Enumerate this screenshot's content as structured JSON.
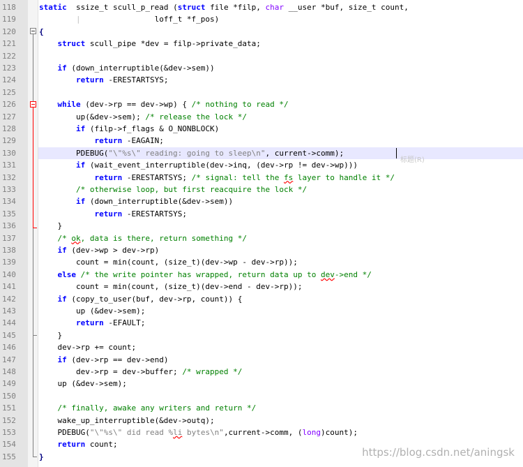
{
  "editor": {
    "current_line": 130,
    "lines": [
      {
        "n": "118",
        "segs": [
          [
            "kw",
            "static"
          ],
          [
            "",
            "  ssize_t scull_p_read ("
          ],
          [
            "kw",
            "struct"
          ],
          [
            "",
            " file *filp, "
          ],
          [
            "ty",
            "char"
          ],
          [
            "",
            " __user *buf, size_t count,"
          ]
        ]
      },
      {
        "n": "119",
        "segs": [
          [
            "tabmark",
            "        |          "
          ],
          [
            "",
            "      loff_t *f_pos)"
          ]
        ]
      },
      {
        "n": "120",
        "segs": [
          [
            "op",
            "{"
          ]
        ]
      },
      {
        "n": "121",
        "segs": [
          [
            "",
            "    "
          ],
          [
            "kw",
            "struct"
          ],
          [
            "",
            " scull_pipe *dev = filp->private_data;"
          ]
        ]
      },
      {
        "n": "122",
        "segs": [
          [
            "",
            ""
          ]
        ]
      },
      {
        "n": "123",
        "segs": [
          [
            "",
            "    "
          ],
          [
            "kw",
            "if"
          ],
          [
            "",
            " (down_interruptible(&dev->sem))"
          ]
        ]
      },
      {
        "n": "124",
        "segs": [
          [
            "",
            "        "
          ],
          [
            "kw",
            "return"
          ],
          [
            "",
            " -ERESTARTSYS;"
          ]
        ]
      },
      {
        "n": "125",
        "segs": [
          [
            "",
            ""
          ]
        ]
      },
      {
        "n": "126",
        "segs": [
          [
            "",
            "    "
          ],
          [
            "kw",
            "while"
          ],
          [
            "",
            " (dev->rp == dev->wp) { "
          ],
          [
            "cm",
            "/* nothing to read */"
          ]
        ]
      },
      {
        "n": "127",
        "segs": [
          [
            "",
            "        up(&dev->sem); "
          ],
          [
            "cm",
            "/* release the lock */"
          ]
        ]
      },
      {
        "n": "128",
        "segs": [
          [
            "",
            "        "
          ],
          [
            "kw",
            "if"
          ],
          [
            "",
            " (filp->f_flags & O_NONBLOCK)"
          ]
        ]
      },
      {
        "n": "129",
        "segs": [
          [
            "",
            "            "
          ],
          [
            "kw",
            "return"
          ],
          [
            "",
            " -EAGAIN;"
          ]
        ]
      },
      {
        "n": "130",
        "segs": [
          [
            "",
            "        PDEBUG("
          ],
          [
            "st",
            "\"\\\"%s\\\" reading: going to sleep\\n\""
          ],
          [
            "",
            ", current->comm);"
          ]
        ]
      },
      {
        "n": "131",
        "segs": [
          [
            "",
            "        "
          ],
          [
            "kw",
            "if"
          ],
          [
            "",
            " (wait_event_interruptible(dev->inq, (dev->rp != dev->wp)))"
          ]
        ]
      },
      {
        "n": "132",
        "segs": [
          [
            "",
            "            "
          ],
          [
            "kw",
            "return"
          ],
          [
            "",
            " -ERESTARTSYS; "
          ],
          [
            "cm",
            "/* signal: tell the "
          ],
          [
            "cm sq",
            "fs"
          ],
          [
            "cm",
            " layer to handle it */"
          ]
        ]
      },
      {
        "n": "133",
        "segs": [
          [
            "",
            "        "
          ],
          [
            "cm",
            "/* otherwise loop, but first reacquire the lock */"
          ]
        ]
      },
      {
        "n": "134",
        "segs": [
          [
            "",
            "        "
          ],
          [
            "kw",
            "if"
          ],
          [
            "",
            " (down_interruptible(&dev->sem))"
          ]
        ]
      },
      {
        "n": "135",
        "segs": [
          [
            "",
            "            "
          ],
          [
            "kw",
            "return"
          ],
          [
            "",
            " -ERESTARTSYS;"
          ]
        ]
      },
      {
        "n": "136",
        "segs": [
          [
            "",
            "    }"
          ]
        ]
      },
      {
        "n": "137",
        "segs": [
          [
            "",
            "    "
          ],
          [
            "cm",
            "/* "
          ],
          [
            "cm sq",
            "ok"
          ],
          [
            "cm",
            ", data is there, return something */"
          ]
        ]
      },
      {
        "n": "138",
        "segs": [
          [
            "",
            "    "
          ],
          [
            "kw",
            "if"
          ],
          [
            "",
            " (dev->wp > dev->rp)"
          ]
        ]
      },
      {
        "n": "139",
        "segs": [
          [
            "",
            "        count = min(count, (size_t)(dev->wp - dev->rp));"
          ]
        ]
      },
      {
        "n": "140",
        "segs": [
          [
            "",
            "    "
          ],
          [
            "kw",
            "else"
          ],
          [
            "",
            " "
          ],
          [
            "cm",
            "/* the write pointer has wrapped, return data up to "
          ],
          [
            "cm sq",
            "dev"
          ],
          [
            "cm",
            "->end */"
          ]
        ]
      },
      {
        "n": "141",
        "segs": [
          [
            "",
            "        count = min(count, (size_t)(dev->end - dev->rp));"
          ]
        ]
      },
      {
        "n": "142",
        "segs": [
          [
            "",
            "    "
          ],
          [
            "kw",
            "if"
          ],
          [
            "",
            " (copy_to_user(buf, dev->rp, count)) {"
          ]
        ]
      },
      {
        "n": "143",
        "segs": [
          [
            "",
            "        up (&dev->sem);"
          ]
        ]
      },
      {
        "n": "144",
        "segs": [
          [
            "",
            "        "
          ],
          [
            "kw",
            "return"
          ],
          [
            "",
            " -EFAULT;"
          ]
        ]
      },
      {
        "n": "145",
        "segs": [
          [
            "",
            "    }"
          ]
        ]
      },
      {
        "n": "146",
        "segs": [
          [
            "",
            "    dev->rp += count;"
          ]
        ]
      },
      {
        "n": "147",
        "segs": [
          [
            "",
            "    "
          ],
          [
            "kw",
            "if"
          ],
          [
            "",
            " (dev->rp == dev->end)"
          ]
        ]
      },
      {
        "n": "148",
        "segs": [
          [
            "",
            "        dev->rp = dev->buffer; "
          ],
          [
            "cm",
            "/* wrapped */"
          ]
        ]
      },
      {
        "n": "149",
        "segs": [
          [
            "",
            "    up (&dev->sem);"
          ]
        ]
      },
      {
        "n": "150",
        "segs": [
          [
            "",
            ""
          ]
        ]
      },
      {
        "n": "151",
        "segs": [
          [
            "",
            "    "
          ],
          [
            "cm",
            "/* finally, awake any writers and return */"
          ]
        ]
      },
      {
        "n": "152",
        "segs": [
          [
            "",
            "    wake_up_interruptible(&dev->outq);"
          ]
        ]
      },
      {
        "n": "153",
        "segs": [
          [
            "",
            "    PDEBUG("
          ],
          [
            "st",
            "\"\\\"%s\\\" did read %"
          ],
          [
            "st sq",
            "li"
          ],
          [
            "st",
            " bytes\\n\""
          ],
          [
            "",
            ",current->comm, ("
          ],
          [
            "ty",
            "long"
          ],
          [
            "",
            ")count);"
          ]
        ]
      },
      {
        "n": "154",
        "segs": [
          [
            "",
            "    "
          ],
          [
            "kw",
            "return"
          ],
          [
            "",
            " count;"
          ]
        ]
      },
      {
        "n": "155",
        "segs": [
          [
            "op",
            "}"
          ]
        ]
      }
    ]
  },
  "ghost_text": "标题(R)",
  "watermark": "https://blog.csdn.net/aningsk",
  "colors": {
    "keyword": "#0000ff",
    "type": "#8000ff",
    "comment": "#008000",
    "string": "#808080",
    "current_line_bg": "#e8e8ff",
    "fold_marker_active": "#ff0000"
  }
}
